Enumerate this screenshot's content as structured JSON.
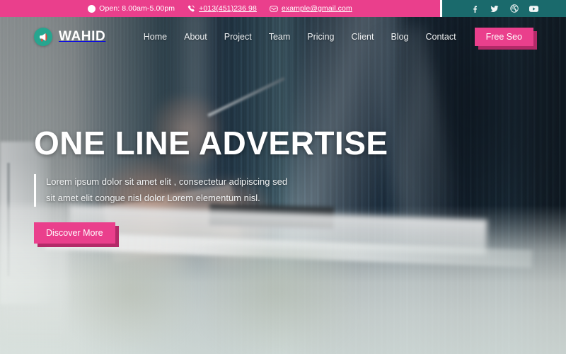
{
  "topbar": {
    "hours": {
      "icon": "clock-icon",
      "text": "Open: 8.00am-5.00pm"
    },
    "phone": {
      "icon": "phone-icon",
      "text": "+013(451)236 98"
    },
    "email": {
      "icon": "envelope-icon",
      "text": "example@gmail.com"
    },
    "socials": [
      {
        "icon": "facebook-icon",
        "name": "Facebook"
      },
      {
        "icon": "twitter-icon",
        "name": "Twitter"
      },
      {
        "icon": "dribbble-icon",
        "name": "Dribbble"
      },
      {
        "icon": "youtube-icon",
        "name": "YouTube"
      }
    ],
    "bg_pink": "#ea3f8c",
    "bg_teal": "#1a6a6c"
  },
  "nav": {
    "brand": {
      "name": "WAHID",
      "icon": "megaphone-icon",
      "mark_color": "#27a58f"
    },
    "links": [
      {
        "label": "Home"
      },
      {
        "label": "About"
      },
      {
        "label": "Project"
      },
      {
        "label": "Team"
      },
      {
        "label": "Pricing"
      },
      {
        "label": "Client"
      },
      {
        "label": "Blog"
      },
      {
        "label": "Contact"
      }
    ],
    "cta": {
      "label": "Free Seo",
      "color": "#ea3f8c",
      "shadow": "#b32a68"
    }
  },
  "hero": {
    "title": "ONE LINE ADVERTISE",
    "paragraph": "Lorem ipsum dolor sit amet elit , consectetur adipiscing sed sit amet elit congue nisl dolor Lorem elementum nisl.",
    "cta": {
      "label": "Discover More",
      "color": "#ea3f8c",
      "shadow": "#b32a68"
    }
  }
}
